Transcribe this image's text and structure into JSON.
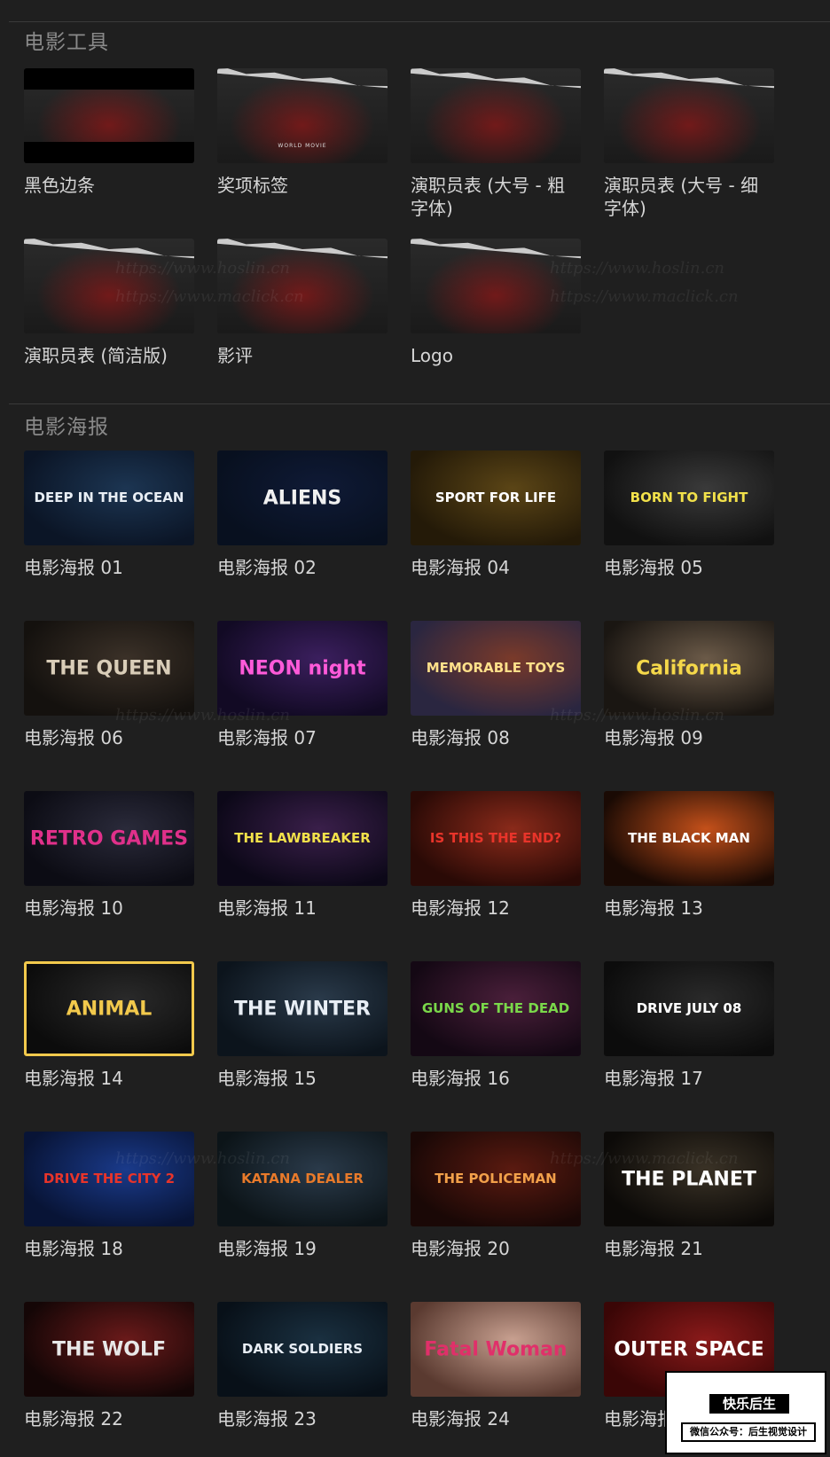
{
  "sections": {
    "tools_title": "电影工具",
    "posters_title": "电影海报"
  },
  "tools": [
    {
      "label": "黑色边条",
      "caption": ""
    },
    {
      "label": "奖项标签",
      "caption": "WORLD MOVIE"
    },
    {
      "label": "演职员表 (大号 - 粗字体)",
      "caption": ""
    },
    {
      "label": "演职员表 (大号 - 细字体)",
      "caption": ""
    },
    {
      "label": "演职员表 (简洁版)",
      "caption": ""
    },
    {
      "label": "影评",
      "caption": ""
    },
    {
      "label": "Logo",
      "caption": ""
    }
  ],
  "posters": [
    {
      "label": "电影海报 01",
      "title": "DEEP IN THE OCEAN",
      "bg1": "#1c3552",
      "bg2": "#0b1526",
      "color": "#e8eef5"
    },
    {
      "label": "电影海报 02",
      "title": "ALIENS",
      "bg1": "#0f1a36",
      "bg2": "#08101f",
      "color": "#f0f0f0"
    },
    {
      "label": "电影海报 04",
      "title": "SPORT FOR LIFE",
      "bg1": "#5b4516",
      "bg2": "#241a08",
      "color": "#ffffff"
    },
    {
      "label": "电影海报 05",
      "title": "BORN TO FIGHT",
      "bg1": "#3a3a3a",
      "bg2": "#111111",
      "color": "#f2e14a"
    },
    {
      "label": "电影海报 06",
      "title": "THE QUEEN",
      "bg1": "#3b3128",
      "bg2": "#14110e",
      "color": "#d9cdb8"
    },
    {
      "label": "电影海报 07",
      "title": "NEON night",
      "bg1": "#3b1f5e",
      "bg2": "#120a24",
      "color": "#ff5ad9"
    },
    {
      "label": "电影海报 08",
      "title": "MEMORABLE TOYS",
      "bg1": "#7a3a2a",
      "bg2": "#2a2640",
      "color": "#ffe08a"
    },
    {
      "label": "电影海报 09",
      "title": "California",
      "bg1": "#6b5a48",
      "bg2": "#1a1612",
      "color": "#f5d84a"
    },
    {
      "label": "电影海报 10",
      "title": "RETRO GAMES",
      "bg1": "#2a2a3a",
      "bg2": "#0c0c14",
      "color": "#e0308a"
    },
    {
      "label": "电影海报 11",
      "title": "THE LAWBREAKER",
      "bg1": "#3a1f4a",
      "bg2": "#0c0818",
      "color": "#f2e14a"
    },
    {
      "label": "电影海报 12",
      "title": "IS THIS THE END?",
      "bg1": "#8a2a1a",
      "bg2": "#2a0a06",
      "color": "#e8342a"
    },
    {
      "label": "电影海报 13",
      "title": "THE BLACK MAN",
      "bg1": "#c4501a",
      "bg2": "#1a0a04",
      "color": "#ffffff"
    },
    {
      "label": "电影海报 14",
      "title": "ANIMAL",
      "bg1": "#2a2a2a",
      "bg2": "#0c0c0c",
      "color": "#f2c94c"
    },
    {
      "label": "电影海报 15",
      "title": "THE WINTER",
      "bg1": "#2a3a4a",
      "bg2": "#0c141c",
      "color": "#e8eef5"
    },
    {
      "label": "电影海报 16",
      "title": "GUNS OF THE DEAD",
      "bg1": "#4a1f3a",
      "bg2": "#140814",
      "color": "#7ad84a"
    },
    {
      "label": "电影海报 17",
      "title": "DRIVE JULY 08",
      "bg1": "#2a2a2a",
      "bg2": "#0c0c0c",
      "color": "#ffffff"
    },
    {
      "label": "电影海报 18",
      "title": "DRIVE THE CITY 2",
      "bg1": "#1a3a8a",
      "bg2": "#081436",
      "color": "#e8342a"
    },
    {
      "label": "电影海报 19",
      "title": "KATANA DEALER",
      "bg1": "#2a3a4a",
      "bg2": "#0c1418",
      "color": "#e87a2a"
    },
    {
      "label": "电影海报 20",
      "title": "THE POLICEMAN",
      "bg1": "#5a1a10",
      "bg2": "#1a0806",
      "color": "#f2a04a"
    },
    {
      "label": "电影海报 21",
      "title": "THE PLANET",
      "bg1": "#3a3226",
      "bg2": "#0c0a08",
      "color": "#ffffff"
    },
    {
      "label": "电影海报 22",
      "title": "THE WOLF",
      "bg1": "#6a1a1a",
      "bg2": "#140606",
      "color": "#e8e8e8"
    },
    {
      "label": "电影海报 23",
      "title": "DARK SOLDIERS",
      "bg1": "#1a3040",
      "bg2": "#081018",
      "color": "#e8eef5"
    },
    {
      "label": "电影海报 24",
      "title": "Fatal Woman",
      "bg1": "#c8a090",
      "bg2": "#5a3a30",
      "color": "#e0306a"
    },
    {
      "label": "电影海报 25",
      "title": "OUTER SPACE",
      "bg1": "#8a1a1a",
      "bg2": "#3a0606",
      "color": "#ffffff"
    }
  ],
  "watermarks": [
    "https://www.hoslin.cn",
    "https://www.maclick.cn"
  ],
  "badge": {
    "title": "快乐后生",
    "subtitle": "微信公众号：后生视觉设计"
  }
}
